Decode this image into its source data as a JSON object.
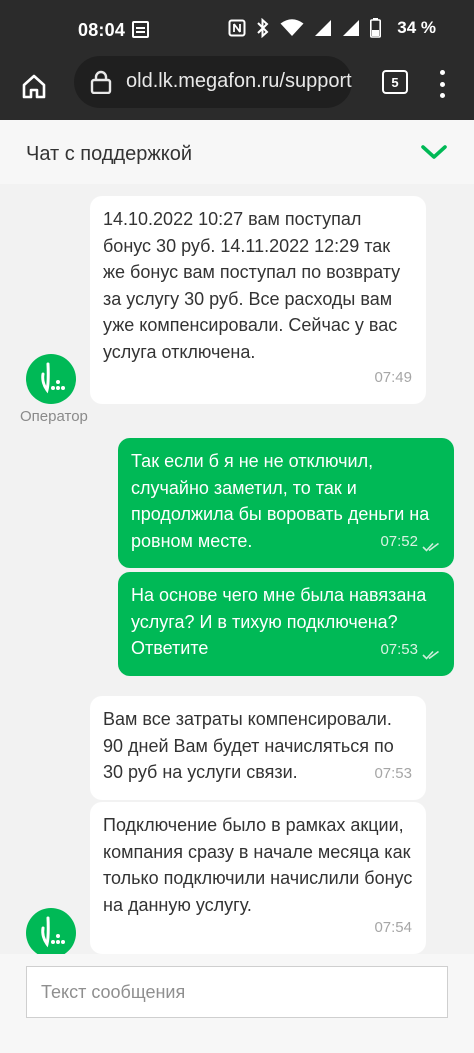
{
  "status_bar": {
    "time": "08:04",
    "battery_pct": "34 %"
  },
  "browser": {
    "url": "old.lk.megafon.ru/support",
    "tab_count": "5"
  },
  "chat": {
    "title": "Чат с поддержкой",
    "operator_label": "Оператор",
    "messages": [
      {
        "from": "operator",
        "text": "14.10.2022 10:27 вам поступал бонус 30 руб. 14.11.2022 12:29 так же бонус вам поступал по возврату за услугу 30 руб. Все расходы вам уже компенсировали. Сейчас у вас услуга отключена.",
        "time": "07:49"
      },
      {
        "from": "user",
        "text": "Так если б я не не отключил, случайно заметил, то так и продолжила бы воровать деньги на ровном месте.",
        "time": "07:52"
      },
      {
        "from": "user",
        "text": "На основе чего мне была навязана услуга? И в тихую подключена? Ответите",
        "time": "07:53"
      },
      {
        "from": "operator",
        "text": "Вам все затраты компенсировали. 90 дней Вам будет начисляться по 30 руб на услуги связи.",
        "time": "07:53"
      },
      {
        "from": "operator",
        "text": "Подключение было в рамках акции, компания сразу в начале месяца как только подключили начислили бонус на данную услугу.",
        "time": "07:54"
      }
    ]
  },
  "input": {
    "placeholder": "Текст сообщения"
  },
  "colors": {
    "brand_green": "#00b956",
    "toolbar": "#2b2b2b"
  }
}
